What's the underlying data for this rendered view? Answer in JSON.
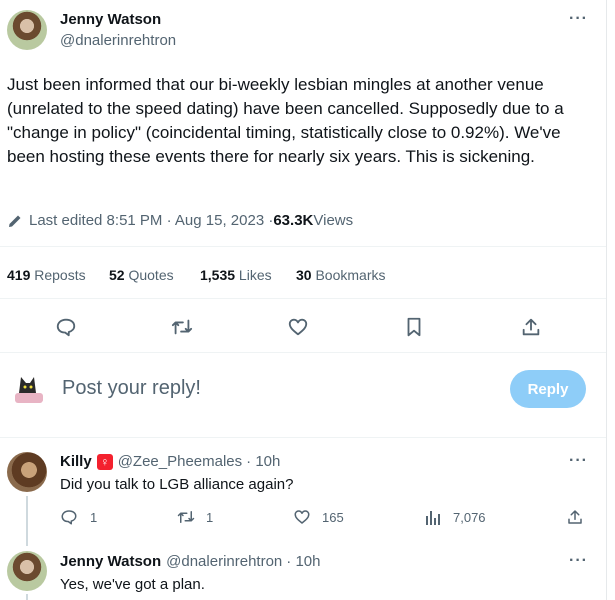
{
  "tweet": {
    "author_name": "Jenny Watson",
    "author_handle": "@dnalerinrehtron",
    "more": "···",
    "text": "Just been informed that our bi-weekly lesbian mingles at another venue (unrelated to the speed dating) have been cancelled. Supposedly due to a \"change in policy\" (coincidental timing, statistically close to 0.92%). We've been hosting these events there for nearly six years. This is sickening.",
    "edited_label": "Last edited 8:51 PM · Aug 15, 2023 · ",
    "views_count": "63.3K",
    "views_label": " Views",
    "stats": {
      "reposts_count": "419",
      "reposts_label": " Reposts",
      "quotes_count": "52",
      "quotes_label": " Quotes",
      "likes_count": "1,535",
      "likes_label": " Likes",
      "bookmarks_count": "30",
      "bookmarks_label": " Bookmarks"
    },
    "actions": [
      "reply-icon",
      "repost-icon",
      "like-icon",
      "bookmark-icon",
      "share-icon"
    ]
  },
  "composer": {
    "placeholder": "Post your reply!",
    "reply_button": "Reply"
  },
  "replies": [
    {
      "name": "Killy",
      "badge": "♀",
      "handle": "@Zee_Pheemales",
      "time": "· 10h",
      "text": "Did you talk to LGB alliance again?",
      "more": "···",
      "reply_count": "1",
      "repost_count": "1",
      "like_count": "165",
      "view_count": "7,076"
    },
    {
      "name": "Jenny Watson",
      "handle": "@dnalerinrehtron",
      "time": "· 10h",
      "text": "Yes, we've got a plan.",
      "more": "···"
    }
  ],
  "colors": {
    "accent": "#1d9bf0",
    "reply_button_disabled": "#8ecdf8",
    "badge": "#f4212e",
    "secondary_text": "#536471"
  }
}
